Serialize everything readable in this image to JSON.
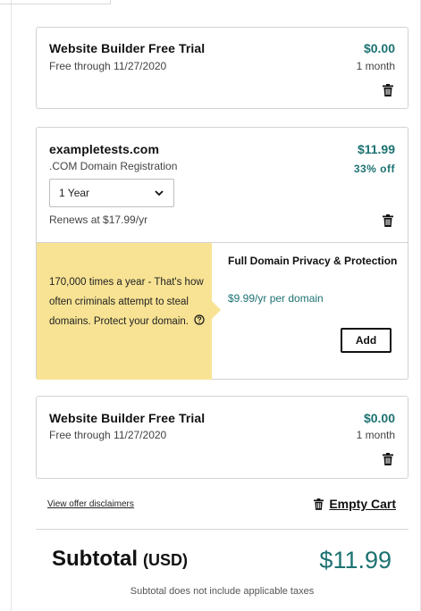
{
  "cart_items": [
    {
      "title": "Website Builder Free Trial",
      "subtitle": "Free through 11/27/2020",
      "price": "$0.00",
      "term": "1 month"
    },
    {
      "title": "exampletests.com",
      "subtitle": ".COM Domain Registration",
      "price": "$11.99",
      "discount": "33% off",
      "term_select": "1 Year",
      "renews": "Renews at $17.99/yr",
      "upsell": {
        "message": "170,000 times a year -  That's how often criminals attempt to steal domains. Protect your domain.",
        "title": "Full Domain Privacy & Protection",
        "price": "$9.99/yr per domain",
        "add_label": "Add"
      }
    },
    {
      "title": "Website Builder Free Trial",
      "subtitle": "Free through 11/27/2020",
      "price": "$0.00",
      "term": "1 month"
    }
  ],
  "links": {
    "disclaimers": "View offer disclaimers",
    "empty_cart": "Empty Cart"
  },
  "summary": {
    "subtotal_label": "Subtotal",
    "currency": "(USD)",
    "subtotal_amount": "$11.99",
    "tax_note": "Subtotal does not include applicable taxes"
  },
  "icons": {
    "delete": "trash-icon",
    "select": "chevron-down-icon",
    "info": "help-circle-icon"
  },
  "colors": {
    "accent": "#1d7272",
    "upsell_bg": "#f8e394"
  }
}
